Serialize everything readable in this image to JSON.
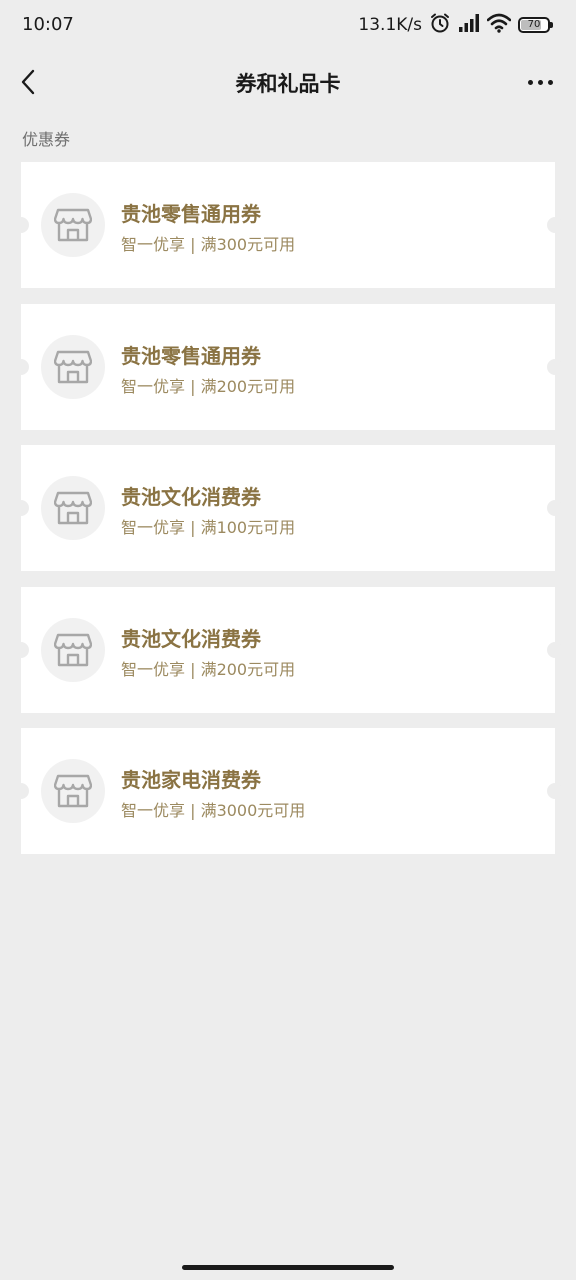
{
  "status_bar": {
    "time": "10:07",
    "net_speed": "13.1K/s",
    "battery": "70",
    "battery_level": 0.7
  },
  "nav": {
    "title": "券和礼品卡"
  },
  "section": {
    "label": "优惠券"
  },
  "coupons": [
    {
      "title": "贵池零售通用券",
      "desc": "智一优享 | 满300元可用"
    },
    {
      "title": "贵池零售通用券",
      "desc": "智一优享 | 满200元可用"
    },
    {
      "title": "贵池文化消费券",
      "desc": "智一优享 | 满100元可用"
    },
    {
      "title": "贵池文化消费券",
      "desc": "智一优享 | 满200元可用"
    },
    {
      "title": "贵池家电消费券",
      "desc": "智一优享 | 满3000元可用"
    }
  ],
  "colors": {
    "accent": "#8a7343",
    "background": "#ededed"
  }
}
